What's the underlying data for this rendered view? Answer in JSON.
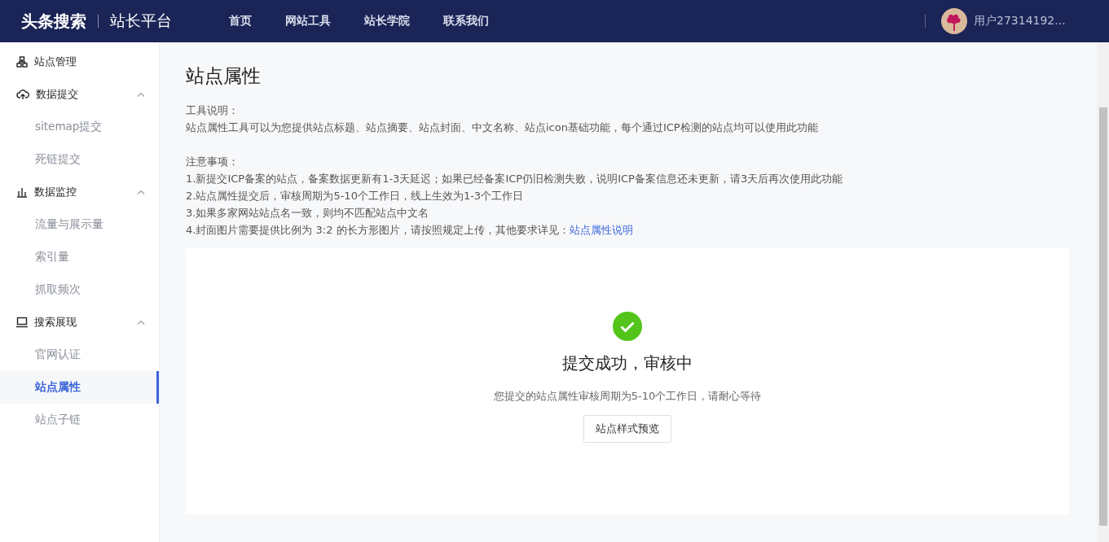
{
  "header": {
    "logo": "头条搜索",
    "platform": "站长平台",
    "nav": [
      {
        "label": "首页"
      },
      {
        "label": "网站工具"
      },
      {
        "label": "站长学院"
      },
      {
        "label": "联系我们"
      }
    ],
    "user": "用户27314192..."
  },
  "sidebar": {
    "items": [
      {
        "label": "站点管理",
        "selected": false
      },
      {
        "label": "数据提交",
        "expanded": true,
        "children": [
          {
            "label": "sitemap提交",
            "selected": false
          },
          {
            "label": "死链提交",
            "selected": false
          }
        ]
      },
      {
        "label": "数据监控",
        "expanded": true,
        "children": [
          {
            "label": "流量与展示量",
            "selected": false
          },
          {
            "label": "索引量",
            "selected": false
          },
          {
            "label": "抓取频次",
            "selected": false
          }
        ]
      },
      {
        "label": "搜索展现",
        "expanded": true,
        "children": [
          {
            "label": "官网认证",
            "selected": false
          },
          {
            "label": "站点属性",
            "selected": true
          },
          {
            "label": "站点子链",
            "selected": false
          }
        ]
      }
    ]
  },
  "page": {
    "title": "站点属性",
    "description": {
      "heading": "工具说明：",
      "text": "站点属性工具可以为您提供站点标题、站点摘要、站点封面、中文名称、站点icon基础功能，每个通过ICP检测的站点均可以使用此功能"
    },
    "notes": {
      "heading": "注意事项：",
      "lines": [
        {
          "text": "1.新提交ICP备案的站点，备案数据更新有1-3天延迟；如果已经备案ICP仍旧检测失败，说明ICP备案信息还未更新，请3天后再次使用此功能"
        },
        {
          "text": "2.站点属性提交后，审核周期为5-10个工作日，线上生效为1-3个工作日"
        },
        {
          "text": "3.如果多家网站站点名一致，则均不匹配站点中文名"
        },
        {
          "text": "4.封面图片需要提供比例为 3:2 的长方形图片，请按照规定上传，其他要求详见：",
          "link": "站点属性说明"
        }
      ]
    },
    "result": {
      "title": "提交成功，审核中",
      "message": "您提交的站点属性审核周期为5-10个工作日，请耐心等待",
      "button": "站点样式预览"
    }
  }
}
